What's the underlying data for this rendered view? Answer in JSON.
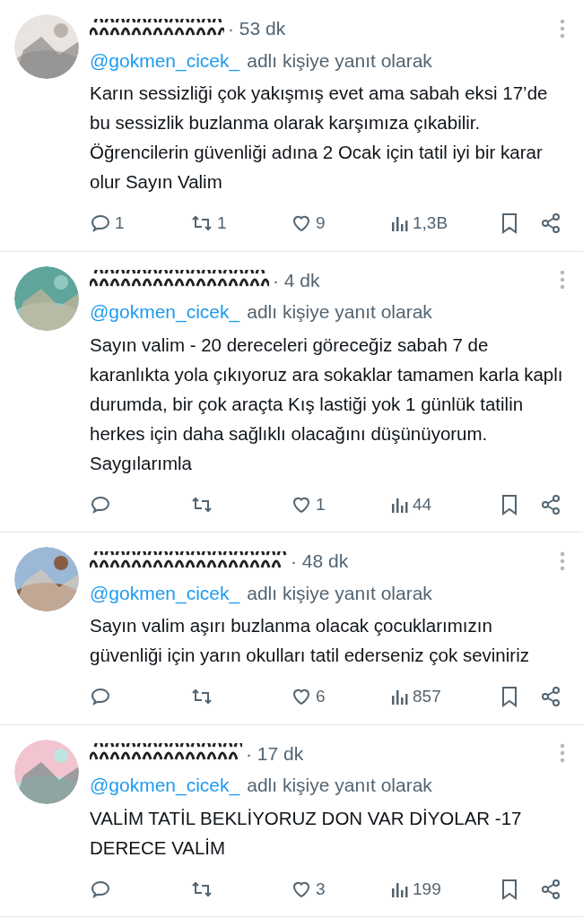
{
  "replies": [
    {
      "time": "· 53 dk",
      "mention": "@gokmen_cicek_",
      "reply_note": "adlı kişiye yanıt olarak",
      "text": "Karın sessizliği çok yakışmış evet ama sabah eksi 17’de bu sessizlik buzlanma olarak karşımıza çıkabilir. Öğrencilerin güvenliği adına 2 Ocak için tatil iyi bir karar olur Sayın Valim",
      "stats": [
        {
          "kind": "reply",
          "count": "1"
        },
        {
          "kind": "repost",
          "count": "1"
        },
        {
          "kind": "like",
          "count": "9"
        },
        {
          "kind": "views",
          "count": "1,3B"
        }
      ]
    },
    {
      "time": "· 4 dk",
      "mention": "@gokmen_cicek_",
      "reply_note": "adlı kişiye yanıt olarak",
      "text": "Sayın valim - 20 dereceleri göreceğiz sabah 7 de karanlıkta yola çıkıyoruz ara sokaklar tamamen karla kaplı durumda, bir çok araçta Kış lastiği yok 1 günlük tatilin herkes için daha sağlıklı olacağını düşünüyorum. Saygılarımla",
      "stats": [
        {
          "kind": "reply"
        },
        {
          "kind": "repost"
        },
        {
          "kind": "like",
          "count": "1"
        },
        {
          "kind": "views",
          "count": "44"
        }
      ]
    },
    {
      "time": "· 48 dk",
      "mention": "@gokmen_cicek_",
      "reply_note": "adlı kişiye yanıt olarak",
      "text": "Sayın valim aşırı buzlanma olacak çocuklarımızın güvenliği için yarın okulları tatil ederseniz çok seviniriz",
      "stats": [
        {
          "kind": "reply"
        },
        {
          "kind": "repost"
        },
        {
          "kind": "like",
          "count": "6"
        },
        {
          "kind": "views",
          "count": "857"
        }
      ]
    },
    {
      "time": "· 17 dk",
      "mention": "@gokmen_cicek_",
      "reply_note": "adlı kişiye yanıt olarak",
      "text": "VALİM TATİL BEKLİYORUZ DON VAR DİYOLAR -17 DERECE VALİM",
      "stats": [
        {
          "kind": "reply"
        },
        {
          "kind": "repost"
        },
        {
          "kind": "like",
          "count": "3"
        },
        {
          "kind": "views",
          "count": "199"
        }
      ]
    }
  ]
}
